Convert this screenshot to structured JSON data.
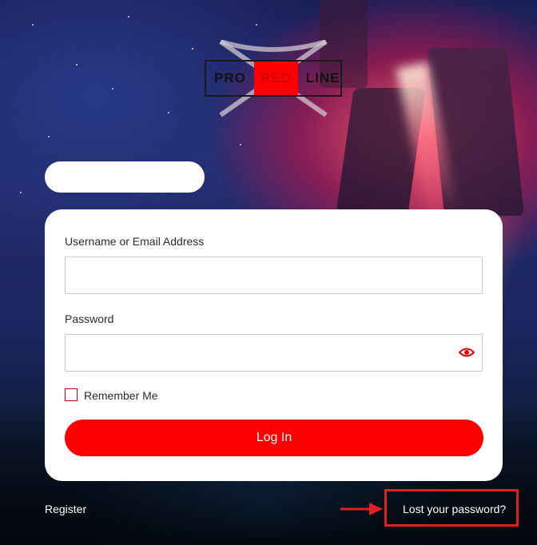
{
  "logo": {
    "word_left": "PRO",
    "word_middle": "RED",
    "word_right": "LINE"
  },
  "form": {
    "username_label": "Username or Email Address",
    "username_value": "",
    "password_label": "Password",
    "password_value": "",
    "remember_label": "Remember Me",
    "remember_checked": false,
    "login_label": "Log In"
  },
  "links": {
    "register": "Register",
    "lost_password": "Lost your password?"
  },
  "icons": {
    "password_toggle": "eye-icon",
    "annotation": "arrow-right-icon"
  },
  "colors": {
    "accent": "#ff0000",
    "annotation": "#e02020"
  }
}
